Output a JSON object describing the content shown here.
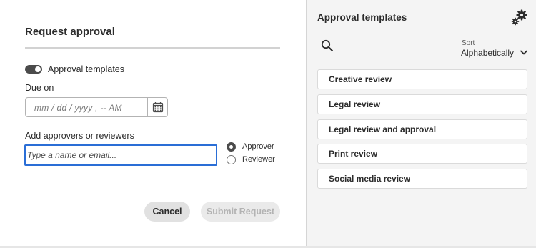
{
  "dialog": {
    "title": "Request approval",
    "toggle_label": "Approval templates",
    "due_label": "Due on",
    "due_placeholder": "mm / dd / yyyy ,  -- AM",
    "add_label": "Add approvers or reviewers",
    "name_placeholder": "Type a name or email...",
    "role_options": [
      "Approver",
      "Reviewer"
    ],
    "selected_role": "Approver",
    "cancel_label": "Cancel",
    "submit_label": "Submit Request"
  },
  "templates_panel": {
    "title": "Approval templates",
    "sort_label": "Sort",
    "sort_value": "Alphabetically",
    "items": [
      {
        "label": "Creative review"
      },
      {
        "label": "Legal review"
      },
      {
        "label": "Legal review and approval"
      },
      {
        "label": "Print review"
      },
      {
        "label": "Social media review"
      }
    ]
  },
  "icons": {
    "gear": "gear-icon",
    "search": "search-icon",
    "calendar": "calendar-icon",
    "chevron": "chevron-down-icon"
  },
  "colors": {
    "focus_ring": "#2a6ed6",
    "toggle_on": "#4b4b4b",
    "panel_bg": "#f4f4f4"
  }
}
